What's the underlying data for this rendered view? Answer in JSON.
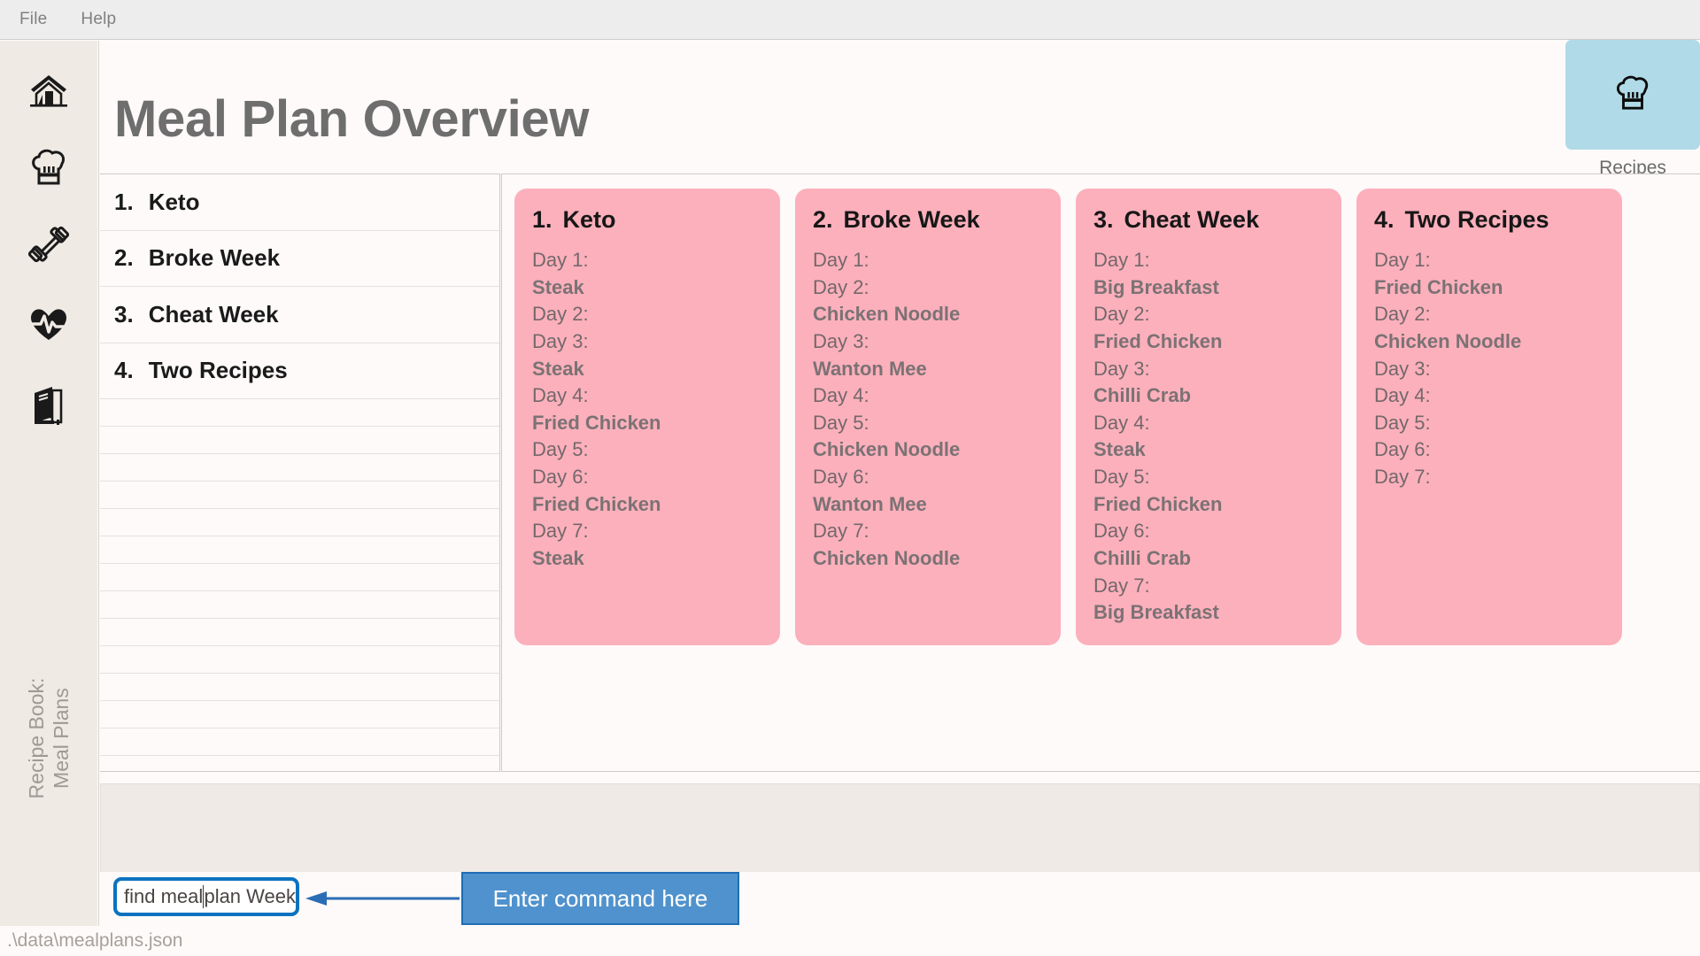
{
  "menubar": {
    "items": [
      {
        "label": "File"
      },
      {
        "label": "Help"
      }
    ]
  },
  "sidebar": {
    "vertical_label": "Recipe Book:\nMeal Plans",
    "items": [
      {
        "icon": "home-icon",
        "name": "home"
      },
      {
        "icon": "chef-hat-icon",
        "name": "recipes"
      },
      {
        "icon": "dumbbell-icon",
        "name": "workouts"
      },
      {
        "icon": "heartbeat-icon",
        "name": "health"
      },
      {
        "icon": "book-icon",
        "name": "book"
      }
    ]
  },
  "header": {
    "title": "Meal Plan Overview",
    "recipes_button": {
      "icon": "chef-hat-icon",
      "label": "Recipes"
    }
  },
  "list_panel": {
    "rows": [
      {
        "num": "1.",
        "label": "Keto"
      },
      {
        "num": "2.",
        "label": "Broke Week"
      },
      {
        "num": "3.",
        "label": "Cheat Week"
      },
      {
        "num": "4.",
        "label": "Two Recipes"
      }
    ],
    "empty_row_count": 16
  },
  "cards": [
    {
      "num": "1.",
      "title": "Keto",
      "days": [
        {
          "day": "Day 1:",
          "meal": "Steak"
        },
        {
          "day": "Day 2:",
          "meal": ""
        },
        {
          "day": "Day 3:",
          "meal": "Steak"
        },
        {
          "day": "Day 4:",
          "meal": "Fried Chicken"
        },
        {
          "day": "Day 5:",
          "meal": ""
        },
        {
          "day": "Day 6:",
          "meal": "Fried Chicken"
        },
        {
          "day": "Day 7:",
          "meal": "Steak"
        }
      ]
    },
    {
      "num": "2.",
      "title": "Broke Week",
      "days": [
        {
          "day": "Day 1:",
          "meal": ""
        },
        {
          "day": "Day 2:",
          "meal": "Chicken Noodle"
        },
        {
          "day": "Day 3:",
          "meal": "Wanton Mee"
        },
        {
          "day": "Day 4:",
          "meal": ""
        },
        {
          "day": "Day 5:",
          "meal": "Chicken Noodle"
        },
        {
          "day": "Day 6:",
          "meal": "Wanton Mee"
        },
        {
          "day": "Day 7:",
          "meal": "Chicken Noodle"
        }
      ]
    },
    {
      "num": "3.",
      "title": "Cheat Week",
      "days": [
        {
          "day": "Day 1:",
          "meal": "Big Breakfast"
        },
        {
          "day": "Day 2:",
          "meal": "Fried Chicken"
        },
        {
          "day": "Day 3:",
          "meal": "Chilli Crab"
        },
        {
          "day": "Day 4:",
          "meal": "Steak"
        },
        {
          "day": "Day 5:",
          "meal": "Fried Chicken"
        },
        {
          "day": "Day 6:",
          "meal": "Chilli Crab"
        },
        {
          "day": "Day 7:",
          "meal": "Big Breakfast"
        }
      ]
    },
    {
      "num": "4.",
      "title": "Two Recipes",
      "days": [
        {
          "day": "Day 1:",
          "meal": "Fried Chicken"
        },
        {
          "day": "Day 2:",
          "meal": "Chicken Noodle"
        },
        {
          "day": "Day 3:",
          "meal": ""
        },
        {
          "day": "Day 4:",
          "meal": ""
        },
        {
          "day": "Day 5:",
          "meal": ""
        },
        {
          "day": "Day 6:",
          "meal": ""
        },
        {
          "day": "Day 7:",
          "meal": ""
        }
      ]
    }
  ],
  "console": {
    "output": ""
  },
  "command": {
    "value_before_caret": "find meal",
    "value_after_caret": "plan Week",
    "full_value": "find mealplan Week",
    "callout_label": "Enter command here"
  },
  "statusbar": {
    "path": ".\\data\\mealplans.json"
  },
  "colors": {
    "card_pink": "#fcb0bc",
    "recipes_button_blue": "#b0dae7",
    "callout_blue": "#4f92cd",
    "input_border_blue": "#0c72bf",
    "rail_beige": "#efeae3",
    "console_beige": "#efeae6"
  }
}
